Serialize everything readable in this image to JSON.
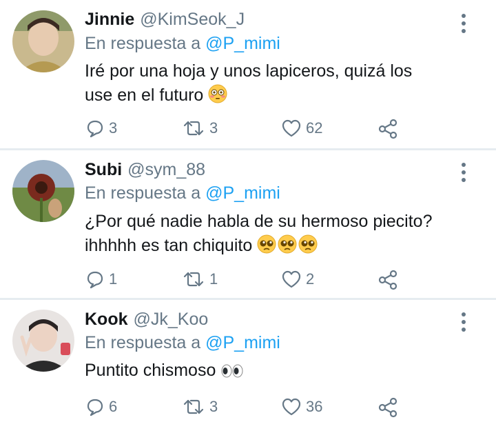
{
  "tweets": [
    {
      "name": "Jinnie",
      "handle": "@KimSeok_J",
      "reply_prefix": "En respuesta a",
      "reply_to": "@P_mimi",
      "text_line1": "Iré por una hoja y unos lapiceros, quizá los",
      "text_line2": "use en el futuro",
      "replies": "3",
      "retweets": "3",
      "likes": "62",
      "emoji": "flushed-face"
    },
    {
      "name": "Subi",
      "handle": "@sym_88",
      "reply_prefix": "En respuesta a",
      "reply_to": "@P_mimi",
      "text_line1": "¿Por qué nadie habla de su hermoso piecito?",
      "text_line2": "ihhhhh es tan chiquito",
      "replies": "1",
      "retweets": "1",
      "likes": "2",
      "emoji": "pleading-face"
    },
    {
      "name": "Kook",
      "handle": "@Jk_Koo",
      "reply_prefix": "En respuesta a",
      "reply_to": "@P_mimi",
      "text_line1": "Puntito chismoso",
      "replies": "6",
      "retweets": "3",
      "likes": "36",
      "emoji": "eyes"
    }
  ],
  "colors": {
    "text": "#14171a",
    "secondary": "#657786",
    "link": "#1da1f2",
    "divider": "#e6ecf0"
  }
}
